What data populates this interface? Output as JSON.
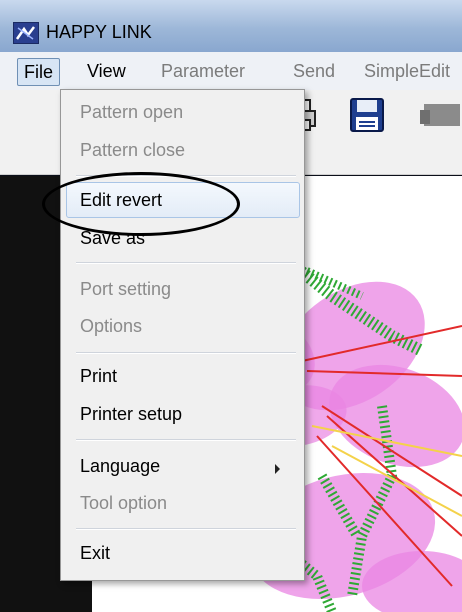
{
  "window": {
    "title": "HAPPY LINK"
  },
  "menubar": {
    "file": "File",
    "view": "View",
    "parameter": "Parameter",
    "send": "Send",
    "simpleedit": "SimpleEdit"
  },
  "file_menu": {
    "items": [
      {
        "label": "Pattern open",
        "enabled": false
      },
      {
        "label": "Pattern close",
        "enabled": false
      },
      {
        "label": "Edit revert",
        "enabled": true
      },
      {
        "label": "Save as",
        "enabled": true
      },
      {
        "label": "Port setting",
        "enabled": false
      },
      {
        "label": "Options",
        "enabled": false
      },
      {
        "label": "Print",
        "enabled": true
      },
      {
        "label": "Printer setup",
        "enabled": true
      },
      {
        "label": "Language",
        "enabled": true
      },
      {
        "label": "Tool option",
        "enabled": false
      },
      {
        "label": "Exit",
        "enabled": true
      }
    ]
  },
  "colors": {
    "title_bar": "#9db7d8",
    "menu_bg": "#f0f0f0",
    "highlight_border": "#a9c5e6",
    "disabled_text": "#8a8a8a",
    "embroidery_pink": "#e985e3",
    "embroidery_green": "#2fa935",
    "embroidery_red": "#e22a2a",
    "embroidery_yellow": "#f4d24a"
  }
}
